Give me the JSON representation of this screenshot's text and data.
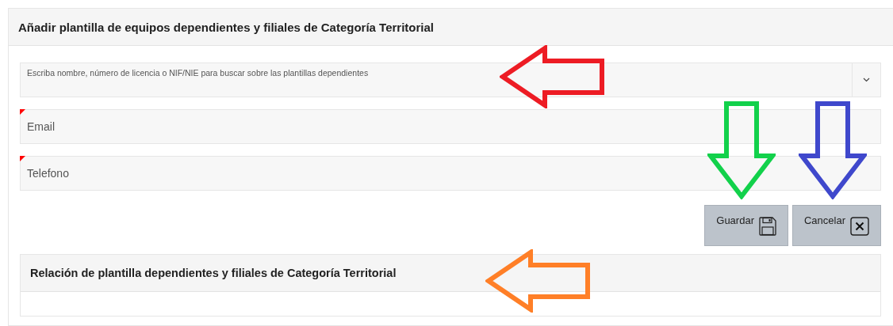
{
  "panel": {
    "title": "Añadir plantilla de equipos dependientes y filiales de Categoría Territorial"
  },
  "search": {
    "placeholder": "Escriba nombre, número de licencia o NIF/NIE para buscar sobre las plantillas dependientes"
  },
  "fields": [
    {
      "placeholder": "Email",
      "required": true
    },
    {
      "placeholder": "Telefono",
      "required": true
    }
  ],
  "buttons": [
    {
      "label": "Guardar",
      "kind": "save"
    },
    {
      "label": "Cancelar",
      "kind": "cancel"
    }
  ],
  "list_panel": {
    "title": "Relación de plantilla dependientes y filiales de Categoría Territorial"
  },
  "annotations": [
    {
      "kind": "left",
      "color": "#ed1c24"
    },
    {
      "kind": "down",
      "color": "#12d14b"
    },
    {
      "kind": "down",
      "color": "#3f48cc"
    },
    {
      "kind": "left",
      "color": "#ff7f27"
    }
  ]
}
